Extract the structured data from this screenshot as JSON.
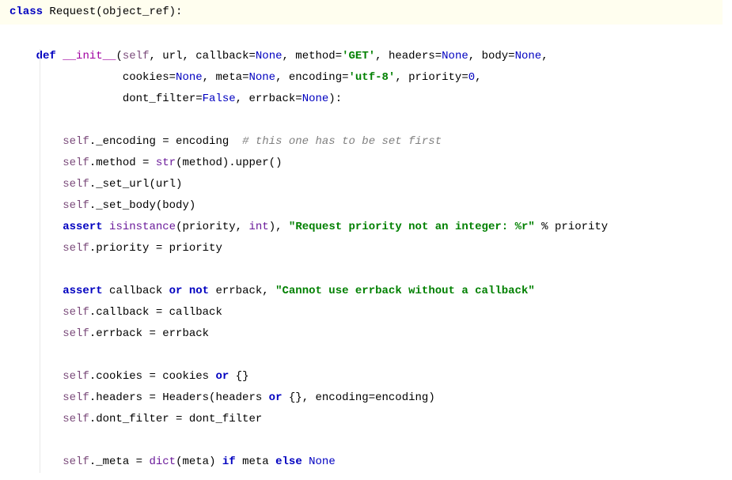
{
  "code": {
    "class_kw": "class",
    "class_name": " Request(object_ref):",
    "def_kw": "def",
    "init_name": "__init__",
    "sig_open": "(",
    "sig_self": "self",
    "sig_p1": ", url, callback=",
    "sig_none1": "None",
    "sig_p2": ", method=",
    "sig_str_get": "'GET'",
    "sig_p3": ", headers=",
    "sig_none2": "None",
    "sig_p4": ", body=",
    "sig_none3": "None",
    "sig_p4b": ",",
    "sig_line2a": "cookies=",
    "sig_none4": "None",
    "sig_line2b": ", meta=",
    "sig_none5": "None",
    "sig_line2c": ", encoding=",
    "sig_str_utf": "'utf-8'",
    "sig_line2d": ", priority=",
    "sig_num0": "0",
    "sig_line2e": ",",
    "sig_line3a": "dont_filter=",
    "sig_false": "False",
    "sig_line3b": ", errback=",
    "sig_none6": "None",
    "sig_line3c": "):",
    "body_self1": "self",
    "body_enc_attr": "._encoding = encoding  ",
    "body_comment": "# this one has to be set first",
    "body_self2": "self",
    "body_method_attr": ".method = ",
    "body_str_call": "str",
    "body_method_rest": "(method).upper()",
    "body_self3": "self",
    "body_seturl": "._set_url(url)",
    "body_self4": "self",
    "body_setbody": "._set_body(body)",
    "assert_kw1": "assert",
    "isinstance_call": " isinstance",
    "isinstance_args1": "(priority, ",
    "int_builtin": "int",
    "isinstance_args2": "), ",
    "assert_str1": "\"Request priority not an integer: %r\"",
    "assert_tail1": " % priority",
    "body_self5": "self",
    "body_priority": ".priority = priority",
    "assert_kw2": "assert",
    "assert_cb": " callback ",
    "or_kw1": "or",
    "not_kw1": " not",
    "assert_eb": " errback, ",
    "assert_str2": "\"Cannot use errback without a callback\"",
    "body_self6": "self",
    "body_callback": ".callback = callback",
    "body_self7": "self",
    "body_errback": ".errback = errback",
    "body_self8": "self",
    "body_cookies_a": ".cookies = cookies ",
    "or_kw2": "or",
    "body_cookies_b": " {}",
    "body_self9": "self",
    "body_headers_a": ".headers = Headers(headers ",
    "or_kw3": "or",
    "body_headers_b": " {}, encoding=encoding)",
    "body_self10": "self",
    "body_dontfilter": ".dont_filter = dont_filter",
    "body_self11": "self",
    "body_meta_a": "._meta = ",
    "dict_call": "dict",
    "body_meta_b": "(meta) ",
    "if_kw": "if",
    "body_meta_c": " meta ",
    "else_kw": "else",
    "body_meta_none": " None"
  }
}
